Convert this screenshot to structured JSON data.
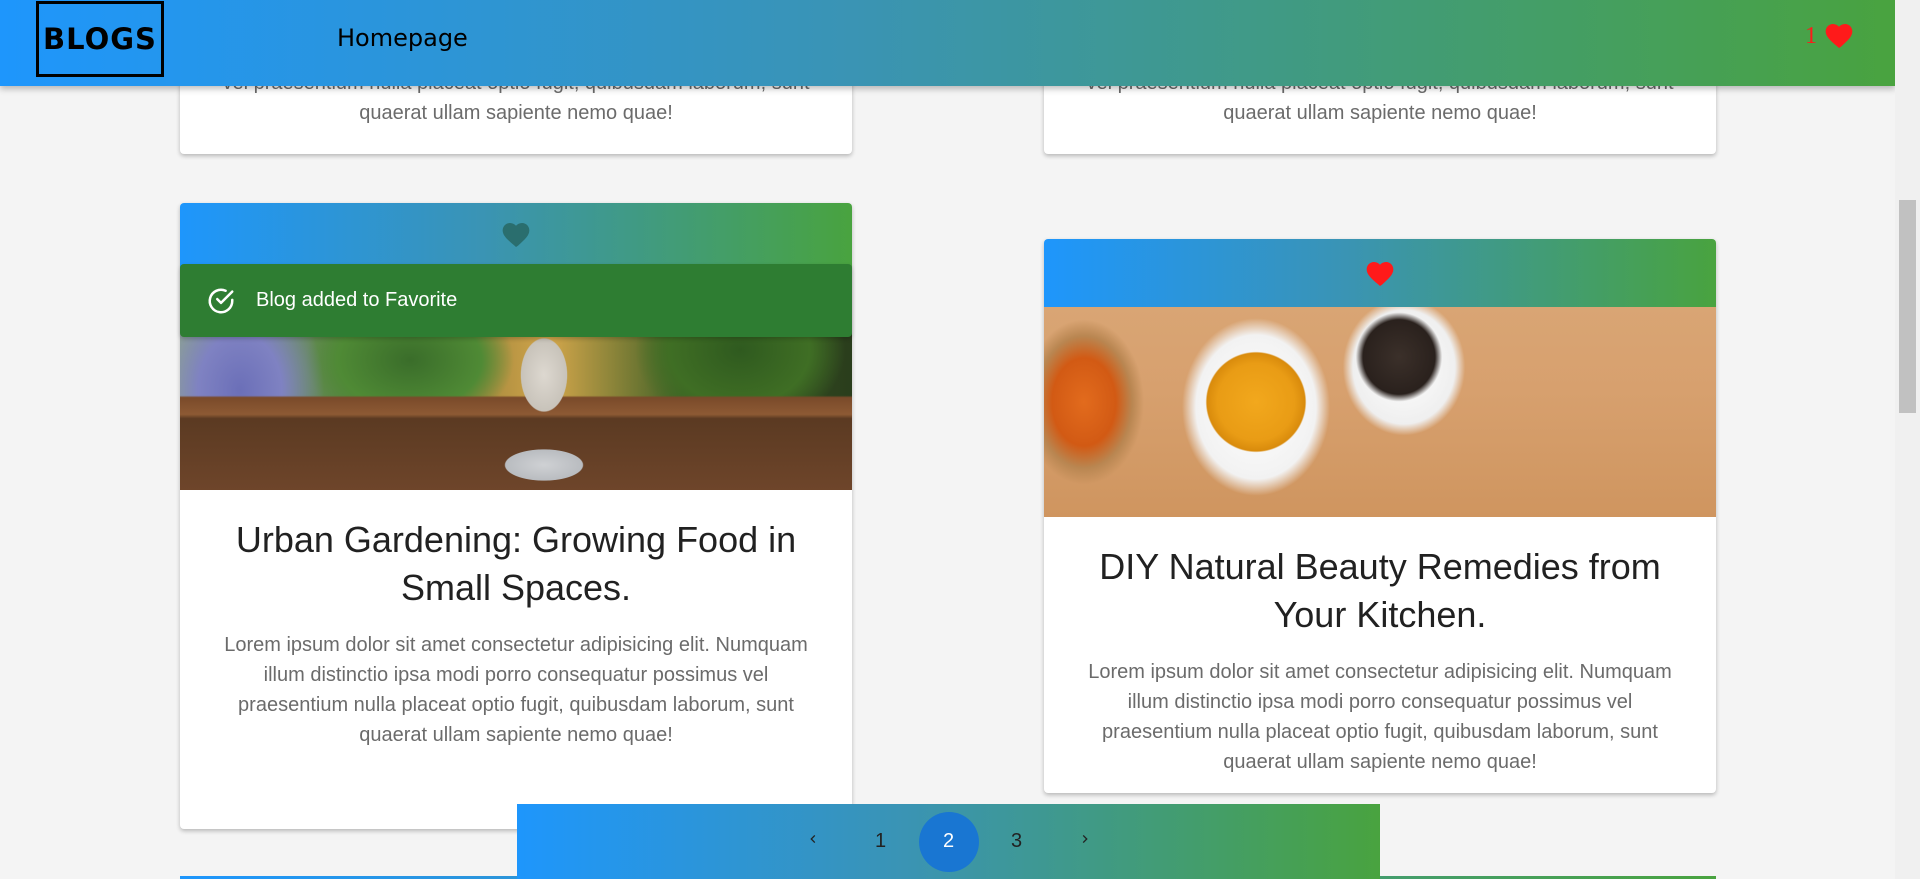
{
  "colors": {
    "gradient_start": "#1e96fc",
    "gradient_end": "#49a33f",
    "favorite_red": "#ff1a1a",
    "toast_green": "#2e7d32",
    "active_page": "#1976d2"
  },
  "header": {
    "brand": "BLOGS",
    "nav_link": "Homepage",
    "favorites_count": "1",
    "favorites_icon": "heart-icon"
  },
  "cards_previous": [
    {
      "desc": "vel praesentium nulla placeat optio fugit, quibusdam laborum, sunt quaerat ullam sapiente nemo quae!"
    },
    {
      "desc": "vel praesentium nulla placeat optio fugit, quibusdam laborum, sunt quaerat ullam sapiente nemo quae!"
    }
  ],
  "cards": [
    {
      "favorite": false,
      "image_icon": "garden-photo",
      "title": "Urban Gardening: Growing Food in Small Spaces.",
      "desc": "Lorem ipsum dolor sit amet consectetur adipisicing elit. Numquam illum distinctio ipsa modi porro consequatur possimus vel praesentium nulla placeat optio fugit, quibusdam laborum, sunt quaerat ullam sapiente nemo quae!"
    },
    {
      "favorite": true,
      "image_icon": "spices-photo",
      "title": "DIY Natural Beauty Remedies from Your Kitchen.",
      "desc": "Lorem ipsum dolor sit amet consectetur adipisicing elit. Numquam illum distinctio ipsa modi porro consequatur possimus vel praesentium nulla placeat optio fugit, quibusdam laborum, sunt quaerat ullam sapiente nemo quae!"
    }
  ],
  "toast": {
    "icon": "check-circle-icon",
    "message": "Blog added to Favorite"
  },
  "pagination": {
    "prev_icon": "chevron-left-icon",
    "next_icon": "chevron-right-icon",
    "pages": [
      "1",
      "2",
      "3"
    ],
    "current": "2"
  }
}
